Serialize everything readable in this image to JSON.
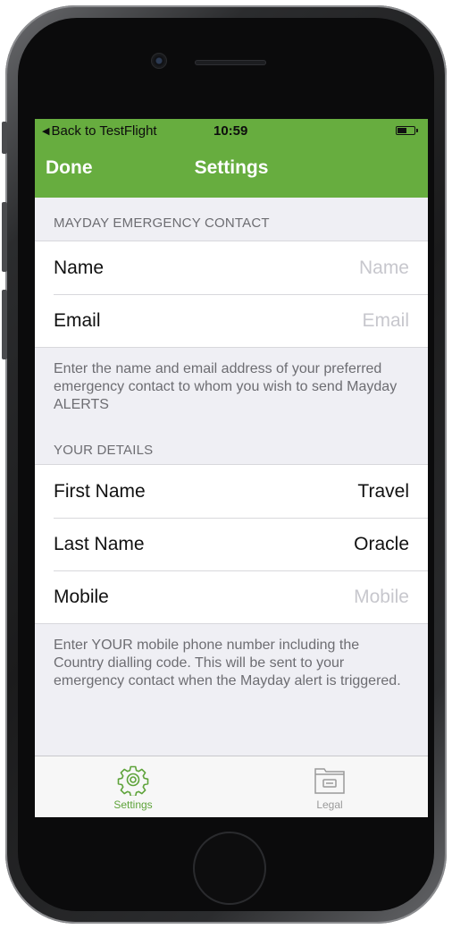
{
  "status_bar": {
    "back_label": "Back to TestFlight",
    "time": "10:59",
    "battery_level": 0.55
  },
  "nav": {
    "done_label": "Done",
    "title": "Settings"
  },
  "emergency_section": {
    "header": "MAYDAY EMERGENCY CONTACT",
    "rows": [
      {
        "label": "Name",
        "value": "",
        "placeholder": "Name"
      },
      {
        "label": "Email",
        "value": "",
        "placeholder": "Email"
      }
    ],
    "footer": "Enter the name and email address of your preferred emergency contact to whom you wish to send Mayday ALERTS"
  },
  "details_section": {
    "header": "YOUR DETAILS",
    "rows": [
      {
        "label": "First Name",
        "value": "Travel"
      },
      {
        "label": "Last Name",
        "value": "Oracle"
      },
      {
        "label": "Mobile",
        "value": "",
        "placeholder": "Mobile"
      }
    ],
    "footer": "Enter YOUR mobile phone number including the Country dialling code. This will be sent to your emergency contact when the Mayday alert is triggered."
  },
  "tab_bar": {
    "tabs": [
      {
        "label": "Settings",
        "icon": "gear-icon",
        "selected": true
      },
      {
        "label": "Legal",
        "icon": "folder-icon",
        "selected": false
      }
    ]
  },
  "colors": {
    "accent": "#67ad3f",
    "tab_selected": "#5ea33a",
    "tab_unselected": "#9a9a9a",
    "background": "#efeff4"
  }
}
